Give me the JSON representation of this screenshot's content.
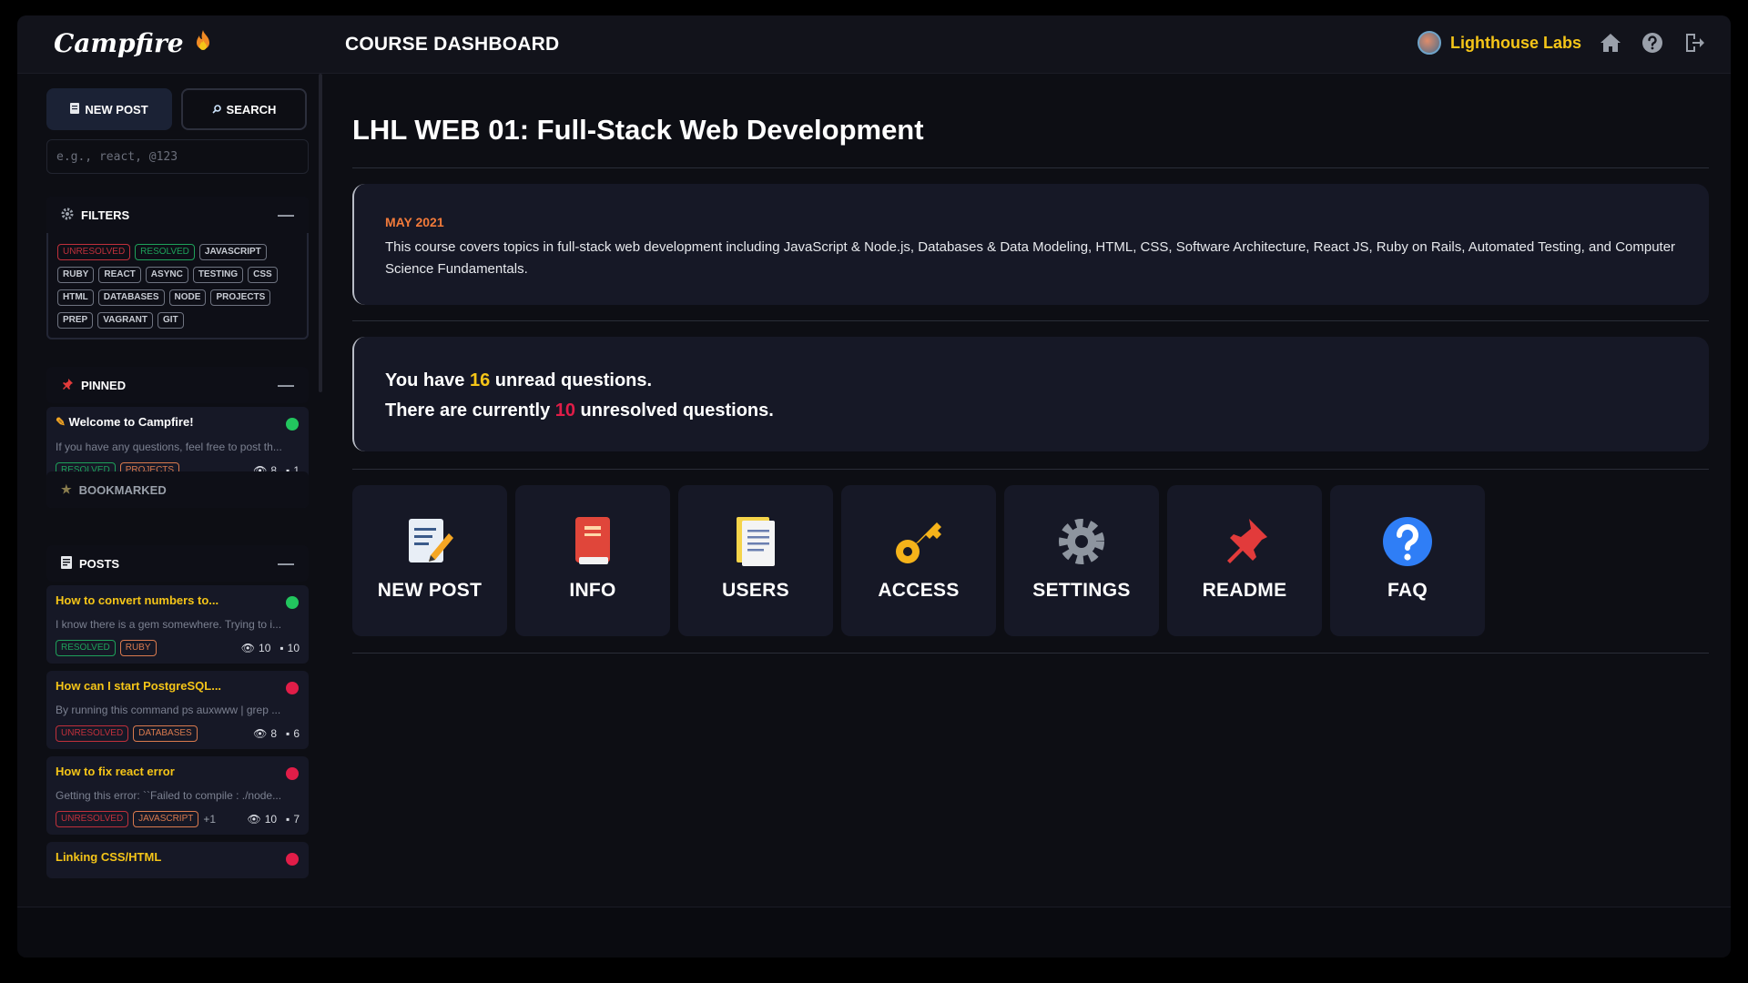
{
  "brand": {
    "name": "Campfire",
    "icon": "fire-icon"
  },
  "header": {
    "title": "COURSE DASHBOARD",
    "org_name": "Lighthouse Labs",
    "icons": [
      "home-icon",
      "help-icon",
      "logout-icon"
    ]
  },
  "sidebar": {
    "new_post_label": "NEW POST",
    "search_label": "SEARCH",
    "search_placeholder": "e.g., react, @123",
    "filters": {
      "title": "FILTERS",
      "tags": [
        "UNRESOLVED",
        "RESOLVED",
        "JAVASCRIPT",
        "RUBY",
        "REACT",
        "ASYNC",
        "TESTING",
        "CSS",
        "HTML",
        "DATABASES",
        "NODE",
        "PROJECTS",
        "PREP",
        "VAGRANT",
        "GIT"
      ]
    },
    "pinned": {
      "title": "PINNED",
      "post": {
        "title": "Welcome to Campfire!",
        "preview": "If you have any questions, feel free to post th...",
        "tags": [
          "RESOLVED",
          "PROJECTS"
        ],
        "views": "8",
        "comments": "1",
        "status": "resolved"
      }
    },
    "bookmarked": {
      "title": "BOOKMARKED"
    },
    "posts": {
      "title": "POSTS",
      "items": [
        {
          "title": "How to convert numbers to...",
          "preview": "I know there is a gem somewhere. Trying to i...",
          "tags": [
            "RESOLVED",
            "RUBY"
          ],
          "extra": "",
          "views": "10",
          "comments": "10",
          "status": "resolved"
        },
        {
          "title": "How can I start PostgreSQL...",
          "preview": "By running this command ps auxwww | grep ...",
          "tags": [
            "UNRESOLVED",
            "DATABASES"
          ],
          "extra": "",
          "views": "8",
          "comments": "6",
          "status": "unresolved"
        },
        {
          "title": "How to fix react error",
          "preview": "Getting this error: ``Failed to compile : ./node...",
          "tags": [
            "UNRESOLVED",
            "JAVASCRIPT"
          ],
          "extra": "+1",
          "views": "10",
          "comments": "7",
          "status": "unresolved"
        },
        {
          "title": "Linking CSS/HTML",
          "status": "unresolved"
        }
      ]
    }
  },
  "main": {
    "course_title": "LHL WEB 01: Full-Stack Web Development",
    "term": "MAY 2021",
    "description": "This course covers topics in full-stack web development including JavaScript & Node.js, Databases & Data Modeling, HTML, CSS, Software Architecture, React JS, Ruby on Rails, Automated Testing, and Computer Science Fundamentals.",
    "unread": {
      "prefix": "You have ",
      "count": "16",
      "suffix": " unread questions."
    },
    "unresolved": {
      "prefix": "There are currently ",
      "count": "10",
      "suffix": " unresolved questions."
    },
    "tiles": [
      {
        "label": "NEW POST",
        "icon": "memo-icon"
      },
      {
        "label": "INFO",
        "icon": "book-icon"
      },
      {
        "label": "USERS",
        "icon": "document-icon"
      },
      {
        "label": "ACCESS",
        "icon": "key-icon"
      },
      {
        "label": "SETTINGS",
        "icon": "gear-icon"
      },
      {
        "label": "README",
        "icon": "pushpin-icon"
      },
      {
        "label": "FAQ",
        "icon": "question-icon"
      }
    ]
  },
  "colors": {
    "accent_yellow": "#f5c518",
    "term_orange": "#f27a3a",
    "unresolved_red": "#e11d48",
    "resolved_green": "#22c55e"
  }
}
